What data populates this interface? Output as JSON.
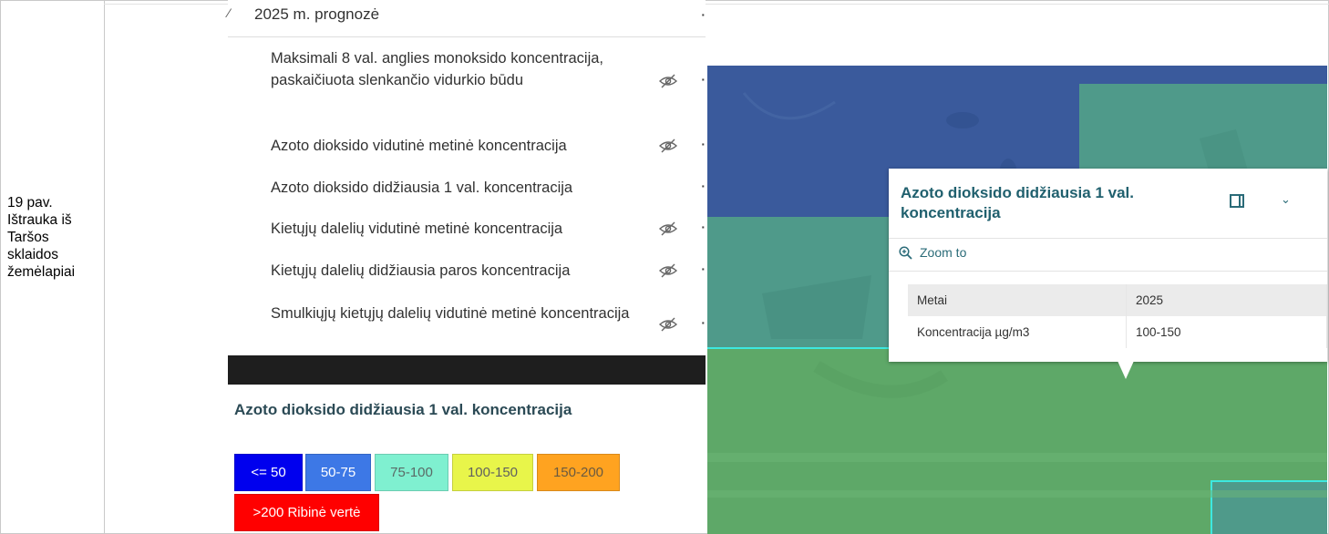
{
  "caption": {
    "lines": [
      "19 pav.",
      "Ištrauka iš",
      "Taršos",
      "sklaidos",
      "žemėlapiai"
    ]
  },
  "layer_list": {
    "group_title": "2025 m. prognozė",
    "layers": [
      {
        "label": "Maksimali 8 val. anglies monoksido koncentracija, paskaičiuota slenkančio vidurkio būdu",
        "hidden": true
      },
      {
        "label": "Azoto dioksido vidutinė metinė koncentracija",
        "hidden": true
      },
      {
        "label": "Azoto dioksido didžiausia 1 val. koncentracija",
        "hidden": false
      },
      {
        "label": "Kietųjų dalelių vidutinė metinė koncentracija",
        "hidden": true
      },
      {
        "label": "Kietųjų dalelių didžiausia paros koncentracija",
        "hidden": true
      },
      {
        "label": "Smulkiųjų kietųjų dalelių vidutinė metinė koncentracija",
        "hidden": true
      }
    ]
  },
  "legend": {
    "title": "Azoto dioksido didžiausia 1 val. koncentracija",
    "classes": [
      {
        "label": "<= 50",
        "color": "#0000ee",
        "text_color": "#ffffff"
      },
      {
        "label": "50-75",
        "color": "#3d78e6",
        "text_color": "#ffffff"
      },
      {
        "label": "75-100",
        "color": "#7ff0d0",
        "text_color": "#5a6a66"
      },
      {
        "label": "100-150",
        "color": "#e8f54a",
        "text_color": "#606060"
      },
      {
        "label": "150-200",
        "color": "#ffa320",
        "text_color": "#6a5a40"
      },
      {
        "label": ">200 Ribinė vertė",
        "color": "#ff0000",
        "text_color": "#ffffff"
      }
    ]
  },
  "popup": {
    "title": "Azoto dioksido didžiausia 1 val. koncentracija",
    "zoom_label": "Zoom to",
    "attributes": [
      {
        "field": "Metai",
        "value": "2025"
      },
      {
        "field": "Koncentracija µg/m3",
        "value": "100-150"
      }
    ]
  },
  "map": {
    "colors": {
      "band_blue": "#3a5a9c",
      "band_teal": "#4f9a8a",
      "band_green": "#5ea868",
      "outline": "#3de8e0"
    }
  }
}
